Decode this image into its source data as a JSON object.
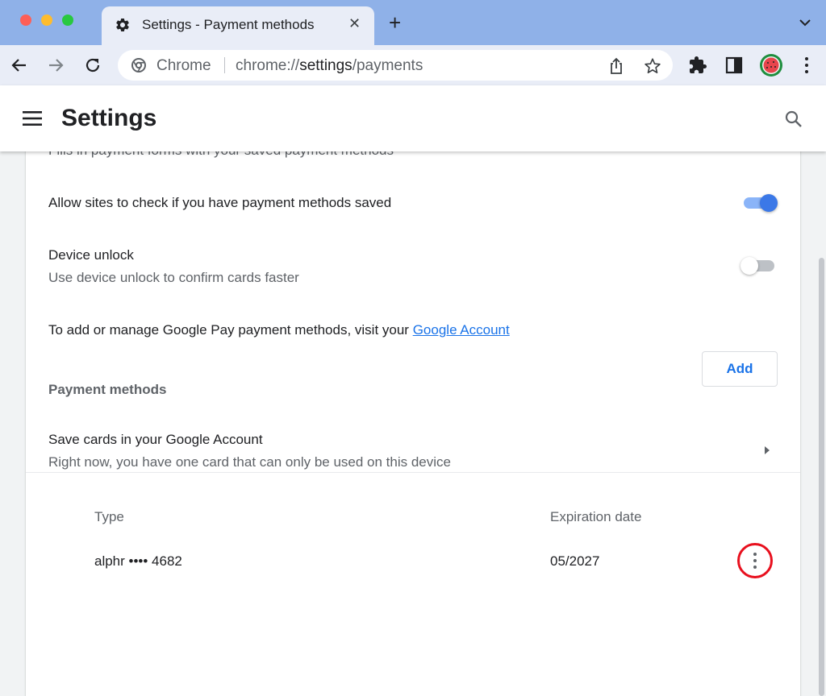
{
  "tab": {
    "title": "Settings - Payment methods"
  },
  "omnibox": {
    "site_label": "Chrome",
    "url_scheme": "chrome://",
    "url_host": "settings",
    "url_path": "/payments"
  },
  "header": {
    "title": "Settings"
  },
  "settings": {
    "partial_text": "Fills in payment forms with your saved payment methods",
    "allow_check": {
      "label": "Allow sites to check if you have payment methods saved",
      "enabled": true
    },
    "device_unlock": {
      "label": "Device unlock",
      "sublabel": "Use device unlock to confirm cards faster",
      "enabled": false
    },
    "google_pay_text": "To add or manage Google Pay payment methods, visit your",
    "google_account_link": "Google Account"
  },
  "payment_methods": {
    "section_label": "Payment methods",
    "add_label": "Add",
    "save_cards": {
      "label": "Save cards in your Google Account",
      "sublabel": "Right now, you have one card that can only be used on this device"
    },
    "columns": {
      "type": "Type",
      "expiration": "Expiration date"
    },
    "cards": [
      {
        "type": "alphr •••• 4682",
        "expiration": "05/2027"
      }
    ]
  },
  "icons": {
    "tab": "gear-icon",
    "tab_close": "close-icon",
    "new_tab": "plus-icon",
    "tab_search": "chevron-down-icon",
    "back": "arrow-left-icon",
    "forward": "arrow-right-icon",
    "reload": "reload-icon",
    "site_info": "chrome-logo-icon",
    "share": "share-icon",
    "bookmark": "star-icon",
    "extensions": "puzzle-icon",
    "side_panel": "side-panel-icon",
    "profile": "avatar",
    "menu": "kebab-menu-icon",
    "drawer": "hamburger-menu-icon",
    "search": "search-icon",
    "open_subpage": "triangle-right-icon",
    "more_actions": "vertical-dots-icon"
  },
  "colors": {
    "accent": "#1a73e8",
    "toggle_on": "#3b78e7",
    "highlight_circle": "#e8101e",
    "tabstrip": "#8fb1e8"
  }
}
